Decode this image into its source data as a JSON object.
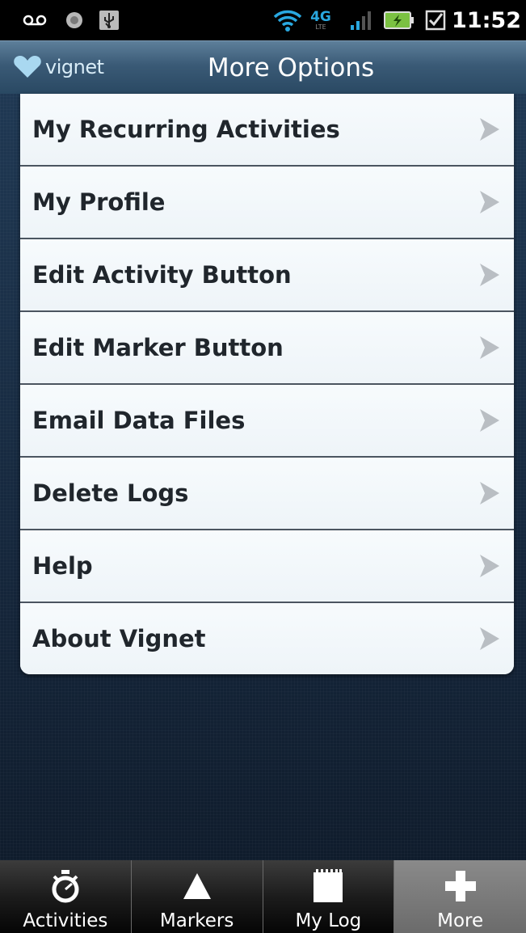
{
  "status_bar": {
    "time": "11:52",
    "network_label": "4G",
    "network_sub": "LTE",
    "icons": [
      "voicemail-icon",
      "record-icon",
      "usb-icon",
      "wifi-icon",
      "signal-icon",
      "battery-charging-icon",
      "checkbox-icon"
    ]
  },
  "header": {
    "brand": "vignet",
    "title": "More Options"
  },
  "menu": {
    "items": [
      {
        "label": "My Recurring Activities"
      },
      {
        "label": "My Profile"
      },
      {
        "label": "Edit Activity Button"
      },
      {
        "label": "Edit Marker Button"
      },
      {
        "label": "Email Data Files"
      },
      {
        "label": "Delete Logs"
      },
      {
        "label": "Help"
      },
      {
        "label": "About Vignet"
      }
    ],
    "chevron_icon": "chevron-right-icon"
  },
  "tabs": {
    "items": [
      {
        "label": "Activities",
        "icon": "stopwatch-icon",
        "active": false
      },
      {
        "label": "Markers",
        "icon": "triangle-icon",
        "active": false
      },
      {
        "label": "My Log",
        "icon": "notepad-icon",
        "active": false
      },
      {
        "label": "More",
        "icon": "plus-icon",
        "active": true
      }
    ]
  },
  "colors": {
    "header_bg": "#3a5a76",
    "brand_heart": "#a9d8f0",
    "menu_text": "#20262c",
    "chevron": "#b9bec3",
    "active_tab": "#7a7a7a"
  }
}
